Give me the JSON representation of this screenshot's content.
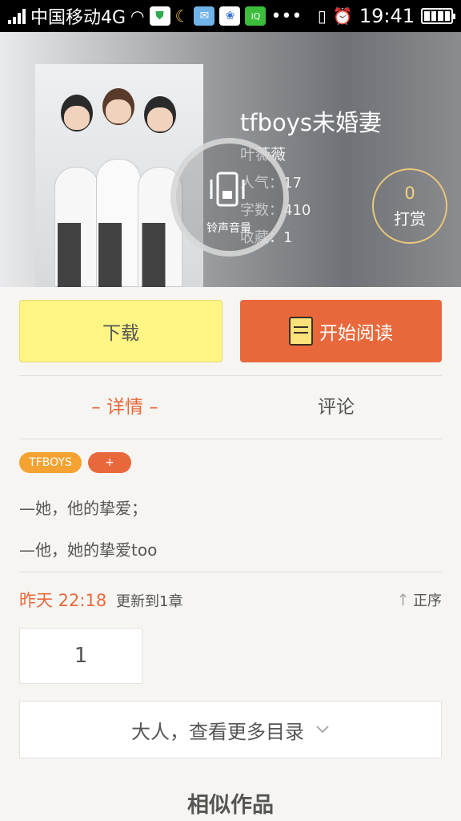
{
  "status_bar": {
    "carrier": "中国移动4G",
    "time": "19:41"
  },
  "book": {
    "title": "tfboys未婚妻",
    "author": "叶薇薇",
    "popularity_label": "人气：",
    "popularity": "17",
    "words_label": "字数：",
    "words": "410",
    "favorites_label": "收藏：",
    "favorites": "1"
  },
  "tip": {
    "count": "0",
    "label": "打赏"
  },
  "ringtone_overlay": {
    "label": "铃声音量"
  },
  "actions": {
    "download": "下载",
    "start_reading": "开始阅读"
  },
  "tabs": {
    "detail": "– 详情 –",
    "comment": "评论"
  },
  "tags": {
    "tag1": "TFBOYS",
    "add": "+"
  },
  "intro": {
    "line1": "—她，他的挚爱；",
    "line2": "—他，她的挚爱too"
  },
  "update": {
    "time": "昨天 22:18",
    "text": "更新到1章",
    "sort": "正序"
  },
  "chapter": {
    "first": "1"
  },
  "more_catalog": "大人，查看更多目录",
  "similar_works": "相似作品",
  "colors": {
    "accent": "#e9683b",
    "download_bg": "#fef584",
    "tag_orange": "#f4a332"
  }
}
